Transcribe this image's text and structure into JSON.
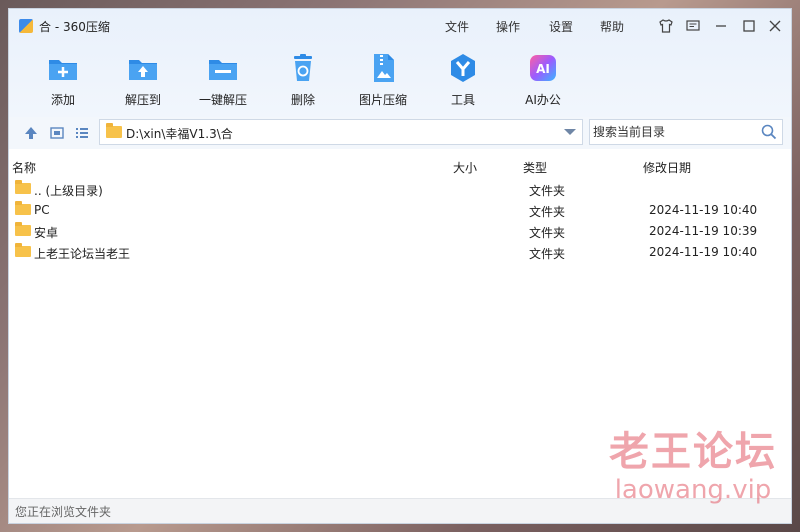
{
  "window": {
    "title": "合 - 360压缩"
  },
  "menu": [
    {
      "label": "文件"
    },
    {
      "label": "操作"
    },
    {
      "label": "设置"
    },
    {
      "label": "帮助"
    }
  ],
  "toolbar": [
    {
      "label": "添加",
      "icon": "add-icon",
      "color": "#2e8be6"
    },
    {
      "label": "解压到",
      "icon": "extract-to-icon",
      "color": "#2e8be6"
    },
    {
      "label": "一键解压",
      "icon": "one-click-extract-icon",
      "color": "#2e8be6"
    },
    {
      "label": "删除",
      "icon": "trash-icon",
      "color": "#2e8be6"
    },
    {
      "label": "图片压缩",
      "icon": "image-compress-icon",
      "color": "#2e8be6"
    },
    {
      "label": "工具",
      "icon": "tools-icon",
      "color": "#2e8be6"
    },
    {
      "label": "AI办公",
      "icon": "ai-office-icon",
      "color": "#a84cf0"
    }
  ],
  "navbar": {
    "path": "D:\\xin\\幸福V1.3\\合",
    "search_placeholder": "搜索当前目录"
  },
  "columns": {
    "name": "名称",
    "size": "大小",
    "type": "类型",
    "modified": "修改日期"
  },
  "files": [
    {
      "name": ".. (上级目录)",
      "type": "文件夹",
      "date": ""
    },
    {
      "name": "PC",
      "type": "文件夹",
      "date": "2024-11-19 10:40"
    },
    {
      "name": "安卓",
      "type": "文件夹",
      "date": "2024-11-19 10:39"
    },
    {
      "name": "上老王论坛当老王",
      "type": "文件夹",
      "date": "2024-11-19 10:40"
    }
  ],
  "status": {
    "text": "您正在浏览文件夹"
  },
  "watermark": {
    "title": "老王论坛",
    "url": "laowang.vip"
  }
}
